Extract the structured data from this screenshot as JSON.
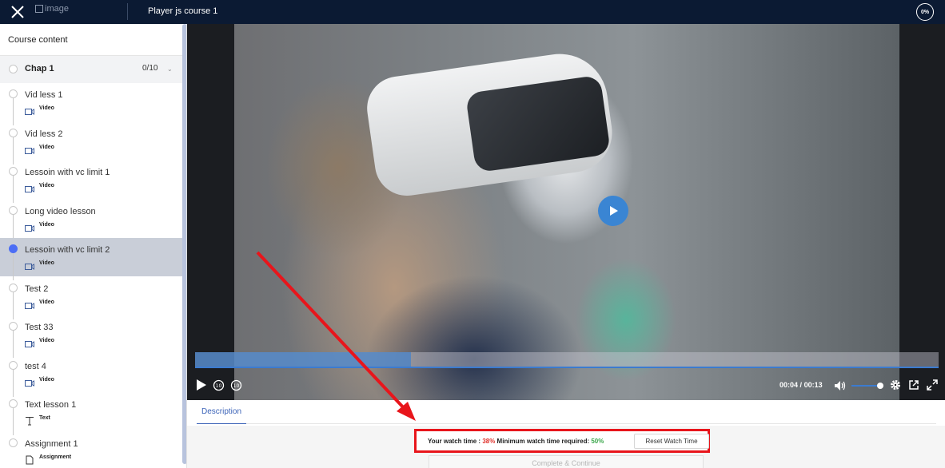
{
  "topbar": {
    "logo_alt": "image",
    "course_title": "Player js course 1",
    "progress": "0%"
  },
  "sidebar": {
    "header": "Course content",
    "chapter": {
      "name": "Chap 1",
      "count": "0/10"
    },
    "lessons": [
      {
        "title": "Vid less 1",
        "type": "Video",
        "icon": "video-icon"
      },
      {
        "title": "Vid less 2",
        "type": "Video",
        "icon": "video-icon"
      },
      {
        "title": "Lessoin with vc limit 1",
        "type": "Video",
        "icon": "video-icon"
      },
      {
        "title": "Long video lesson",
        "type": "Video",
        "icon": "video-icon"
      },
      {
        "title": "Lessoin with vc limit 2",
        "type": "Video",
        "icon": "video-icon",
        "active": true
      },
      {
        "title": "Test 2",
        "type": "Video",
        "icon": "video-icon"
      },
      {
        "title": "Test 33",
        "type": "Video",
        "icon": "video-icon"
      },
      {
        "title": "test 4",
        "type": "Video",
        "icon": "video-icon"
      },
      {
        "title": "Text lesson 1",
        "type": "Text",
        "icon": "text-icon"
      },
      {
        "title": "Assignment 1",
        "type": "Assignment",
        "icon": "document-icon"
      }
    ]
  },
  "player": {
    "current_time": "00:04",
    "separator": "/",
    "duration": "00:13",
    "played_fraction": 0.29,
    "volume_fraction": 0.9
  },
  "tabs": {
    "description": "Description"
  },
  "watch": {
    "label": "Your watch time : ",
    "watch_pct": "38%",
    "min_label": " Minimum watch time required: ",
    "min_pct": "50%",
    "reset_label": "Reset Watch Time"
  },
  "complete_label": "Complete & Continue",
  "colors": {
    "topbar": "#0b1a33",
    "accent": "#3b7bd0",
    "annotation": "#e8151b",
    "watch_red": "#e0312b",
    "watch_green": "#3aa64a"
  }
}
